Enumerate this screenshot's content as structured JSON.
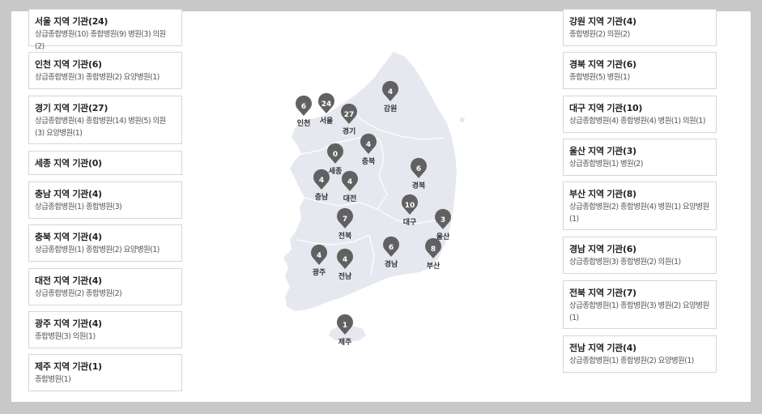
{
  "left_regions": [
    {
      "title": "서울 지역 기관(24)",
      "detail": "상급종합병원(10) 종합병원(9) 병원(3) 의원(2)"
    },
    {
      "title": "인천 지역 기관(6)",
      "detail": "상급종합병원(3) 종합병원(2) 요양병원(1)"
    },
    {
      "title": "경기 지역 기관(27)",
      "detail": "상급종합병원(4) 종합병원(14) 병원(5) 의원(3) 요양병원(1)"
    },
    {
      "title": "세종 지역 기관(0)",
      "detail": ""
    },
    {
      "title": "충남 지역 기관(4)",
      "detail": "상급종합병원(1) 종합병원(3)"
    },
    {
      "title": "충북 지역 기관(4)",
      "detail": "상급종합병원(1) 종합병원(2) 요양병원(1)"
    },
    {
      "title": "대전 지역 기관(4)",
      "detail": "상급종합병원(2) 종합병원(2)"
    },
    {
      "title": "광주 지역 기관(4)",
      "detail": "종합병원(3) 의원(1)"
    },
    {
      "title": "제주 지역 기관(1)",
      "detail": "종합병원(1)"
    }
  ],
  "right_regions": [
    {
      "title": "강원 지역 기관(4)",
      "detail": "종합병원(2) 의원(2)"
    },
    {
      "title": "경북 지역 기관(6)",
      "detail": "종합병원(5) 병원(1)"
    },
    {
      "title": "대구 지역 기관(10)",
      "detail": "상급종합병원(4) 종합병원(4) 병원(1) 의원(1)"
    },
    {
      "title": "울산 지역 기관(3)",
      "detail": "상급종합병원(1) 병원(2)"
    },
    {
      "title": "부산 지역 기관(8)",
      "detail": "상급종합병원(2) 종합병원(4) 병원(1) 요양병원(1)"
    },
    {
      "title": "경남 지역 기관(6)",
      "detail": "상급종합병원(3) 종합병원(2) 의원(1)"
    },
    {
      "title": "전북 지역 기관(7)",
      "detail": "상급종합병원(1) 종합병원(3) 병원(2) 요양병원(1)"
    },
    {
      "title": "전남 지역 기관(4)",
      "detail": "상급종합병원(1) 종합병원(2) 요양병원(1)"
    }
  ],
  "map": {
    "pin_color": "#616161",
    "land_color": "#e6e8f0",
    "pins": [
      {
        "name": "인천",
        "count": "6"
      },
      {
        "name": "서울",
        "count": "24"
      },
      {
        "name": "경기",
        "count": "27"
      },
      {
        "name": "강원",
        "count": "4"
      },
      {
        "name": "세종",
        "count": "0"
      },
      {
        "name": "충북",
        "count": "4"
      },
      {
        "name": "충남",
        "count": "4"
      },
      {
        "name": "대전",
        "count": "4"
      },
      {
        "name": "경북",
        "count": "6"
      },
      {
        "name": "대구",
        "count": "10"
      },
      {
        "name": "울산",
        "count": "3"
      },
      {
        "name": "전북",
        "count": "7"
      },
      {
        "name": "광주",
        "count": "4"
      },
      {
        "name": "전남",
        "count": "4"
      },
      {
        "name": "경남",
        "count": "6"
      },
      {
        "name": "부산",
        "count": "8"
      },
      {
        "name": "제주",
        "count": "1"
      }
    ]
  }
}
